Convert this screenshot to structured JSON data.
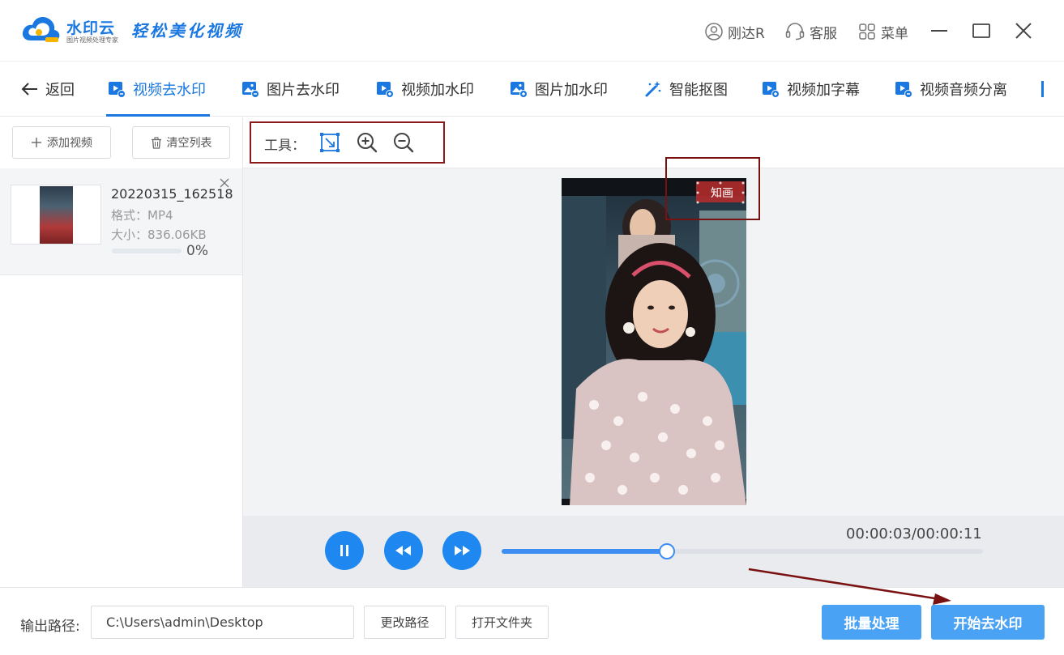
{
  "brand": {
    "name": "水印云",
    "subtitle": "图片视频处理专家",
    "slogan": "轻松美化视频"
  },
  "titlebar": {
    "user": "刚达R",
    "service": "客服",
    "menu": "菜单"
  },
  "nav": {
    "back": "返回",
    "items": [
      {
        "label": "视频去水印",
        "icon": "video-icon",
        "active": true
      },
      {
        "label": "图片去水印",
        "icon": "image-icon"
      },
      {
        "label": "视频加水印",
        "icon": "video-add-icon"
      },
      {
        "label": "图片加水印",
        "icon": "image-add-icon"
      },
      {
        "label": "智能抠图",
        "icon": "magic-wand-icon"
      },
      {
        "label": "视频加字幕",
        "icon": "video-subtitle-icon"
      },
      {
        "label": "视频音频分离",
        "icon": "video-audio-icon"
      }
    ]
  },
  "left": {
    "add_video": "添加视频",
    "clear_list": "清空列表",
    "file": {
      "name": "20220315_162518",
      "format": "格式：MP4",
      "size": "大小：836.06KB",
      "progress_percent": 0,
      "progress_label": "0%"
    }
  },
  "tools": {
    "label": "工具：",
    "icons": [
      "select-area-icon",
      "zoom-in-icon",
      "zoom-out-icon"
    ]
  },
  "preview": {
    "watermark_text": "知画"
  },
  "player": {
    "time": "00:00:03/00:00:11",
    "position_fraction": 0.343,
    "buttons": [
      "pause-icon",
      "rewind-icon",
      "fast-forward-icon"
    ]
  },
  "footer": {
    "output_label": "输出路径:",
    "output_path": "C:\\Users\\admin\\Desktop",
    "change_path": "更改路径",
    "open_folder": "打开文件夹",
    "batch": "批量处理",
    "start": "开始去水印"
  },
  "colors": {
    "accent": "#1b78e0",
    "primary_button": "#4aa2f5",
    "annotation": "#8b1a1a"
  }
}
